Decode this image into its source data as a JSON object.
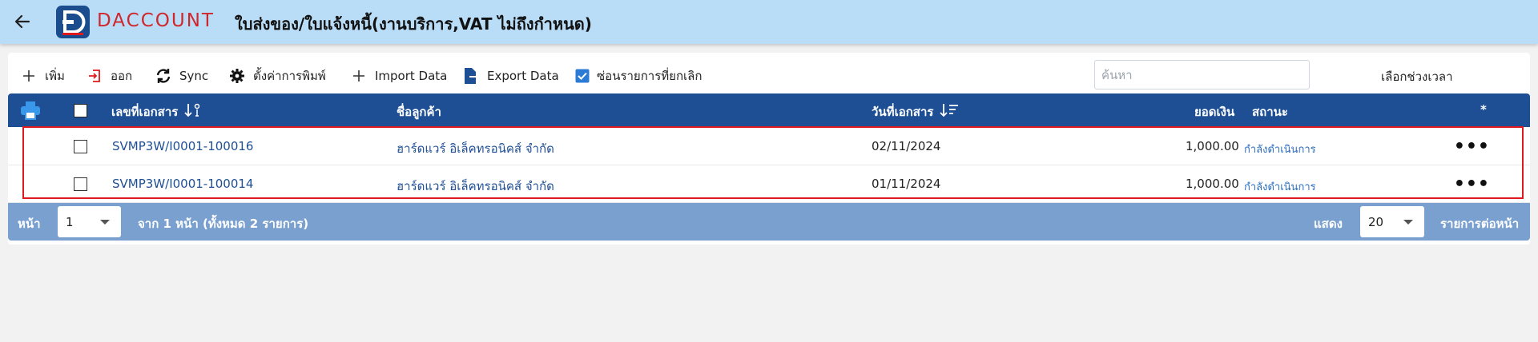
{
  "header": {
    "logo_text": "DACCOUNT",
    "title": "ใบส่งของ/ใบแจ้งหนี้(งานบริการ,VAT ไม่ถึงกำหนด)"
  },
  "toolbar": {
    "add_label": "เพิ่ม",
    "exit_label": "ออก",
    "sync_label": "Sync",
    "print_settings_label": "ตั้งค่าการพิมพ์",
    "import_label": "Import Data",
    "export_label": "Export Data",
    "hide_cancelled_label": "ซ่อนรายการที่ยกเลิก",
    "hide_cancelled_checked": true,
    "search_placeholder": "ค้นหา",
    "period_label": "เลือกช่วงเวลา"
  },
  "table": {
    "columns": {
      "doc_no": "เลขที่เอกสาร",
      "customer": "ชื่อลูกค้า",
      "doc_date": "วันที่เอกสาร",
      "amount": "ยอดเงิน",
      "status": "สถานะ",
      "star": "*"
    },
    "rows": [
      {
        "doc_no": "SVMP3W/I0001-100016",
        "customer": "ฮาร์ดแวร์ อิเล็คทรอนิคส์ จำกัด",
        "doc_date": "02/11/2024",
        "amount": "1,000.00",
        "status": "กำลังดำเนินการ"
      },
      {
        "doc_no": "SVMP3W/I0001-100014",
        "customer": "ฮาร์ดแวร์ อิเล็คทรอนิคส์ จำกัด",
        "doc_date": "01/11/2024",
        "amount": "1,000.00",
        "status": "กำลังดำเนินการ"
      }
    ]
  },
  "footer": {
    "page_label": "หน้า",
    "page_value": "1",
    "page_info": "จาก 1 หน้า (ทั้งหมด 2 รายการ)",
    "show_label": "แสดง",
    "per_page_value": "20",
    "per_page_suffix": "รายการต่อหน้า"
  },
  "colors": {
    "header_bg": "#b9dcf7",
    "table_header": "#1e4f95",
    "footer_bg": "#7aa0cf",
    "brand_red": "#d1262b",
    "highlight_border": "#e0191f"
  }
}
